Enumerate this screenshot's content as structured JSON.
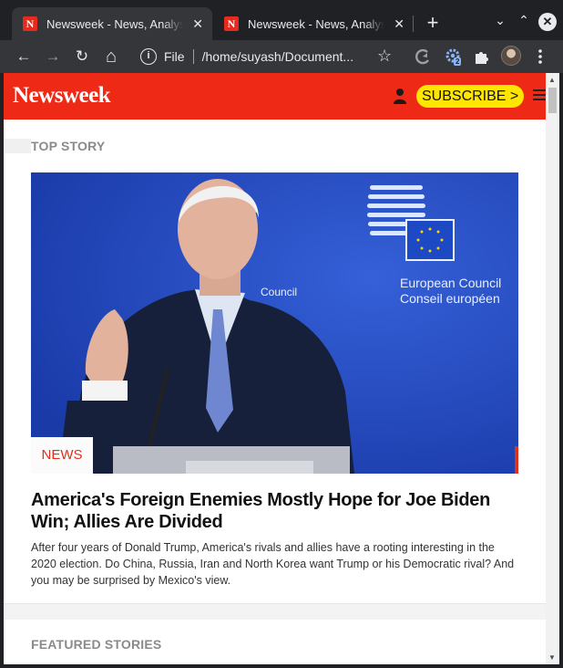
{
  "browser": {
    "tabs": [
      {
        "favicon": "N",
        "title": "Newsweek - News, Analysis",
        "close": "✕"
      },
      {
        "favicon": "N",
        "title": "Newsweek - News, Analysis",
        "close": "✕"
      }
    ],
    "new_tab": "+",
    "window_controls": {
      "minimize": "⌄",
      "maximize": "⌃",
      "close": "✕"
    },
    "toolbar": {
      "back": "←",
      "forward": "→",
      "reload": "↻",
      "home": "⌂"
    },
    "omnibox": {
      "info": "i",
      "scheme": "File",
      "url": "/home/suyash/Document..."
    },
    "bookmark": "☆",
    "extension_badge": "2"
  },
  "page": {
    "logo": "Newsweek",
    "subscribe_label": "SUBSCRIBE >",
    "top_story_label": "TOP STORY",
    "hero": {
      "sign_line1": "European Council",
      "sign_line2": "Conseil européen",
      "partial_sign": "Council"
    },
    "category": "NEWS",
    "headline": "America's Foreign Enemies Mostly Hope for Joe Biden Win; Allies Are Divided",
    "summary": "After four years of Donald Trump, America's rivals and allies have a rooting interesting in the 2020 election. Do China, Russia, Iran and North Korea want Trump or his Democratic rival? And you may be surprised by Mexico's view.",
    "featured_label": "FEATURED STORIES"
  },
  "colors": {
    "brand_red": "#ee2a17",
    "subscribe_yellow": "#ffe600",
    "chrome_dark": "#202124",
    "chrome_toolbar": "#35363a"
  }
}
